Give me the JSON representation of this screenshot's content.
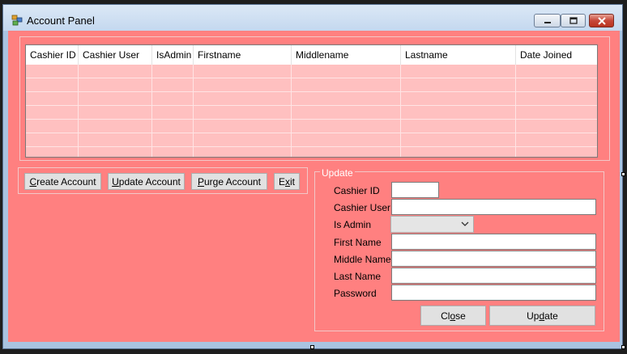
{
  "window": {
    "title": "Account Panel"
  },
  "grid": {
    "columns": [
      "Cashier ID",
      "Cashier User",
      "IsAdmin",
      "Firstname",
      "Middlename",
      "Lastname",
      "Date Joined"
    ],
    "rows": [
      [],
      [],
      [],
      [],
      [],
      []
    ]
  },
  "actions": {
    "create_label": "Create Account",
    "create_key": "C",
    "create_rest": "reate Account",
    "update_key": "U",
    "update_rest": "pdate Account",
    "purge_key": "P",
    "purge_rest": "urge Account",
    "exit_prefix": "E",
    "exit_key": "x",
    "exit_rest": "it"
  },
  "update_form": {
    "legend": "Update",
    "cashier_id_label": "Cashier ID",
    "cashier_user_label": "Cashier User",
    "is_admin_label": "Is Admin",
    "first_name_label": "First Name",
    "middle_name_label": "Middle Name",
    "last_name_label": "Last Name",
    "password_label": "Password",
    "close_prefix": "Cl",
    "close_key": "o",
    "close_rest": "se",
    "update_prefix": "Up",
    "update_key": "d",
    "update_rest": "ate"
  },
  "colors": {
    "client_bg": "#ff8080",
    "grid_bg": "#ffc0c0"
  }
}
